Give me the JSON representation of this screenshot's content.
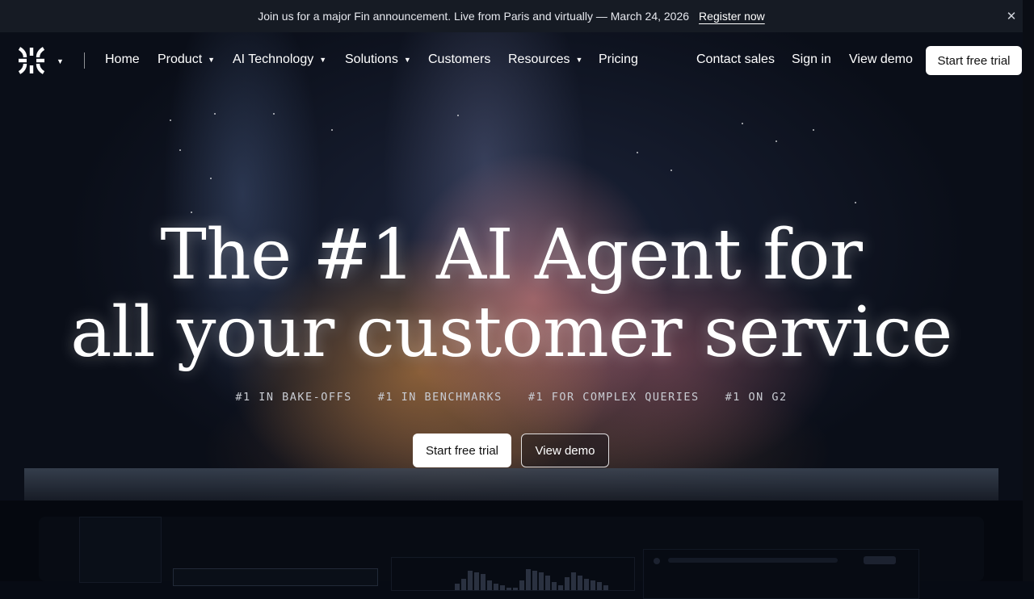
{
  "announcement": {
    "message": "Join us for a major Fin announcement. Live from Paris and virtually — March 24, 2026",
    "link_label": "Register now",
    "close_icon": "close-icon"
  },
  "nav": {
    "logo_icon": "intercom-logo-icon",
    "items": [
      {
        "label": "Home"
      },
      {
        "label": "Product",
        "has_dropdown": true
      },
      {
        "label": "AI Technology",
        "has_dropdown": true
      },
      {
        "label": "Solutions",
        "has_dropdown": true
      },
      {
        "label": "Customers"
      },
      {
        "label": "Resources",
        "has_dropdown": true
      },
      {
        "label": "Pricing"
      }
    ],
    "right": {
      "contact_sales": "Contact sales",
      "sign_in": "Sign in",
      "view_demo": "View demo",
      "start_trial": "Start free trial"
    }
  },
  "hero": {
    "headline_line1": "The #1 AI Agent for",
    "headline_line2": "all your customer service",
    "badges": [
      "#1 IN BAKE-OFFS",
      "#1 IN BENCHMARKS",
      "#1 FOR COMPLEX QUERIES",
      "#1 ON G2"
    ],
    "primary_cta": "Start free trial",
    "secondary_cta": "View demo"
  },
  "colors": {
    "background": "#070b14",
    "announcement_bar": "#161b24",
    "button_primary_bg": "#ffffff",
    "glow_orange": "#e6964a",
    "glow_pink": "#ec8c8c"
  }
}
